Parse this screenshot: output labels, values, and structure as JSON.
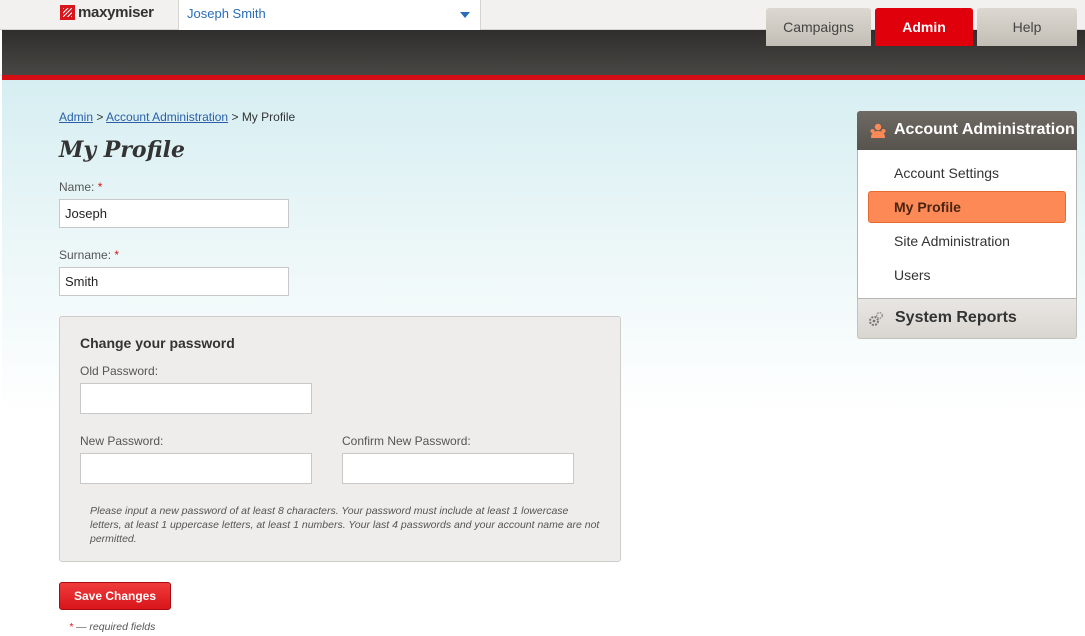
{
  "header": {
    "logo_text": "maxymiser",
    "user_name": "Joseph Smith"
  },
  "nav": {
    "tabs": [
      {
        "label": "Campaigns",
        "active": false
      },
      {
        "label": "Admin",
        "active": true
      },
      {
        "label": "Help",
        "active": false
      }
    ]
  },
  "breadcrumb": {
    "admin": "Admin",
    "separator1": ">",
    "account_admin": "Account Administration",
    "separator2": ">",
    "current": "My Profile"
  },
  "page": {
    "title": "My Profile"
  },
  "form": {
    "name_label": "Name:",
    "name_value": "Joseph",
    "surname_label": "Surname:",
    "surname_value": "Smith",
    "required_mark": "*",
    "password_section_title": "Change your password",
    "old_password_label": "Old Password:",
    "new_password_label": "New Password:",
    "confirm_password_label": "Confirm New Password:",
    "password_hint": "Please input a new password of at least 8 characters. Your password must include at least 1 lowercase letters, at least 1 uppercase letters, at least 1 numbers. Your last 4 passwords and your account name are not permitted.",
    "save_label": "Save Changes",
    "required_note": "— required fields"
  },
  "sidebar": {
    "heading": "Account Administration",
    "items": [
      {
        "label": "Account Settings",
        "active": false
      },
      {
        "label": "My Profile",
        "active": true
      },
      {
        "label": "Site Administration",
        "active": false
      },
      {
        "label": "Users",
        "active": false
      }
    ],
    "reports_heading": "System Reports"
  },
  "colors": {
    "brand_red": "#e0000b",
    "active_orange": "#fd8a56",
    "link_blue": "#2a5fa8"
  }
}
